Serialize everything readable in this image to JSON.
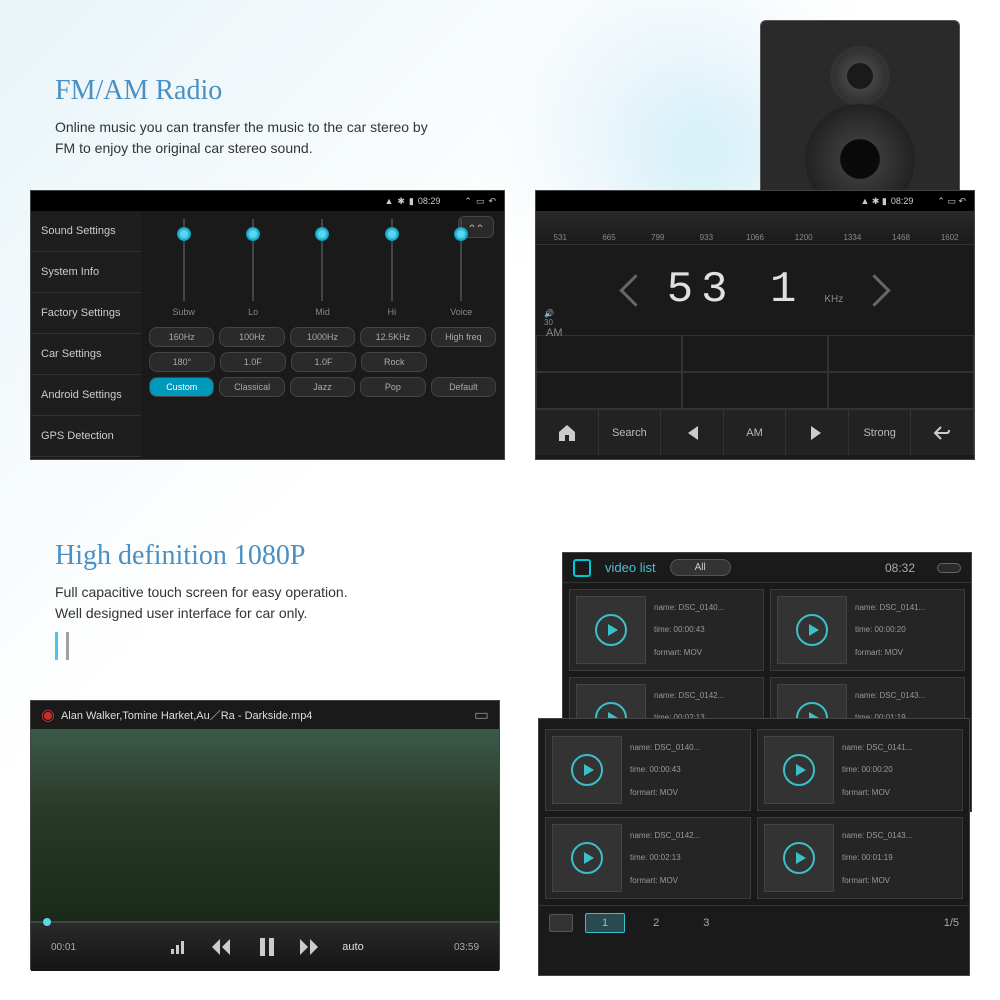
{
  "section1": {
    "title": "FM/AM Radio",
    "desc": "Online music you can transfer the music to the car stereo by FM to enjoy the original car stereo sound."
  },
  "section2": {
    "title": "High definition 1080P",
    "desc": "Full capacitive touch screen for easy operation.\nWell designed user interface for car only."
  },
  "status": {
    "time": "08:29"
  },
  "eq": {
    "sidebar": [
      "Sound Settings",
      "System Info",
      "Factory Settings",
      "Car Settings",
      "Android Settings",
      "GPS Detection"
    ],
    "sliders": [
      "Subw",
      "Lo",
      "Mid",
      "Hi",
      "Voice"
    ],
    "row1": [
      "160Hz",
      "100Hz",
      "1000Hz",
      "12.5KHz",
      "High freq"
    ],
    "row2": [
      "180°",
      "1.0F",
      "1.0F",
      "Rock"
    ],
    "row3": [
      "Custom",
      "Classical",
      "Jazz",
      "Pop"
    ],
    "default": "Default"
  },
  "radio": {
    "ticks": [
      "531",
      "665",
      "799",
      "933",
      "1066",
      "1200",
      "1334",
      "1468",
      "1602"
    ],
    "band": "AM",
    "freq": "53 1",
    "unit": "KHz",
    "vol": "30",
    "buttons": {
      "search": "Search",
      "am": "AM",
      "strong": "Strong"
    }
  },
  "video": {
    "title": "Alan Walker,Tomine Harket,Au／Ra - Darkside.mp4",
    "cur": "00:01",
    "dur": "03:59",
    "auto": "auto"
  },
  "videolist": {
    "title": "video list",
    "all": "All",
    "time": "08:32",
    "items": [
      {
        "name": "DSC_0140...",
        "time": "00:00:43",
        "format": "MOV"
      },
      {
        "name": "DSC_0141...",
        "time": "00:00:20",
        "format": "MOV"
      },
      {
        "name": "DSC_0142...",
        "time": "00:02:13",
        "format": "MOV"
      },
      {
        "name": "DSC_0143...",
        "time": "00:01:19",
        "format": "MOV"
      }
    ],
    "pages": [
      "1",
      "2",
      "3"
    ],
    "pageinfo": "1/5"
  }
}
